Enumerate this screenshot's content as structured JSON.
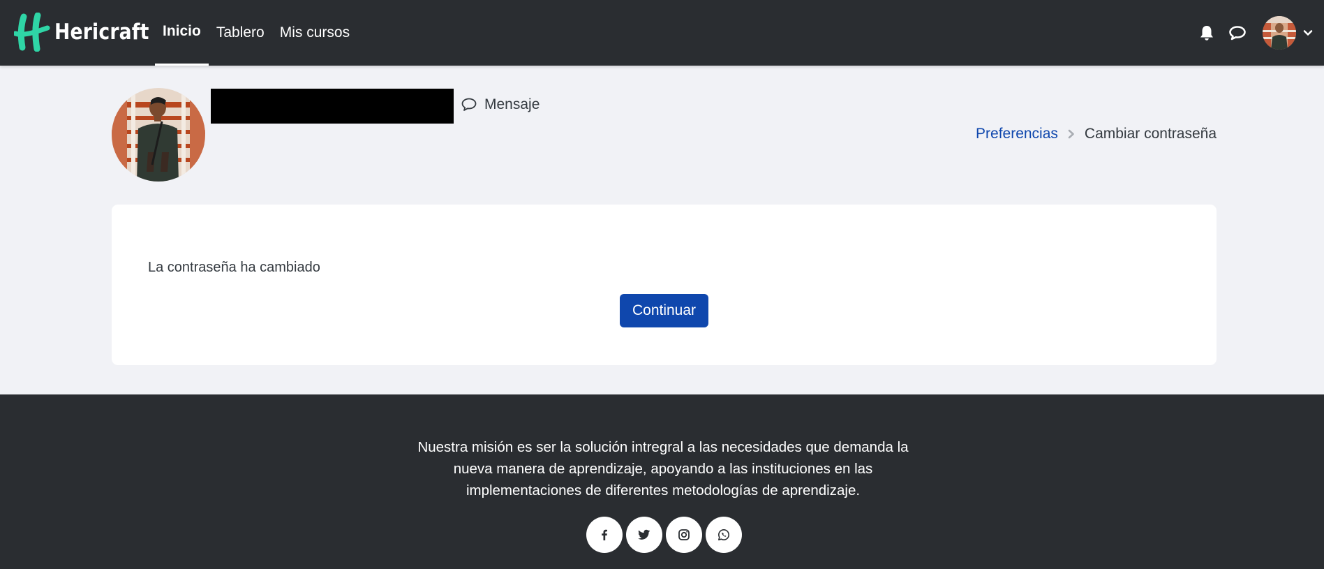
{
  "brand": {
    "name": "Hericraft",
    "accent": "#2fd5a6"
  },
  "nav": {
    "items": [
      {
        "label": "Inicio",
        "active": true
      },
      {
        "label": "Tablero",
        "active": false
      },
      {
        "label": "Mis cursos",
        "active": false
      }
    ],
    "icons": [
      "bell-icon",
      "chat-icon",
      "chevron-down-icon"
    ]
  },
  "profile": {
    "message_label": "Mensaje"
  },
  "breadcrumb": {
    "link": "Preferencias",
    "current": "Cambiar contraseña"
  },
  "card": {
    "message": "La contraseña ha cambiado",
    "button_label": "Continuar"
  },
  "footer": {
    "mission_lines": [
      "Nuestra misión es ser la solución intregral a las necesidades que demanda la",
      "nueva manera de aprendizaje, apoyando a las instituciones en las",
      "implementaciones de diferentes metodologías de aprendizaje."
    ],
    "socials": [
      "facebook-icon",
      "twitter-icon",
      "instagram-icon",
      "whatsapp-icon"
    ]
  },
  "colors": {
    "navbar_bg": "#2a2d31",
    "page_bg": "#f1f2f6",
    "primary": "#0f47ad"
  }
}
